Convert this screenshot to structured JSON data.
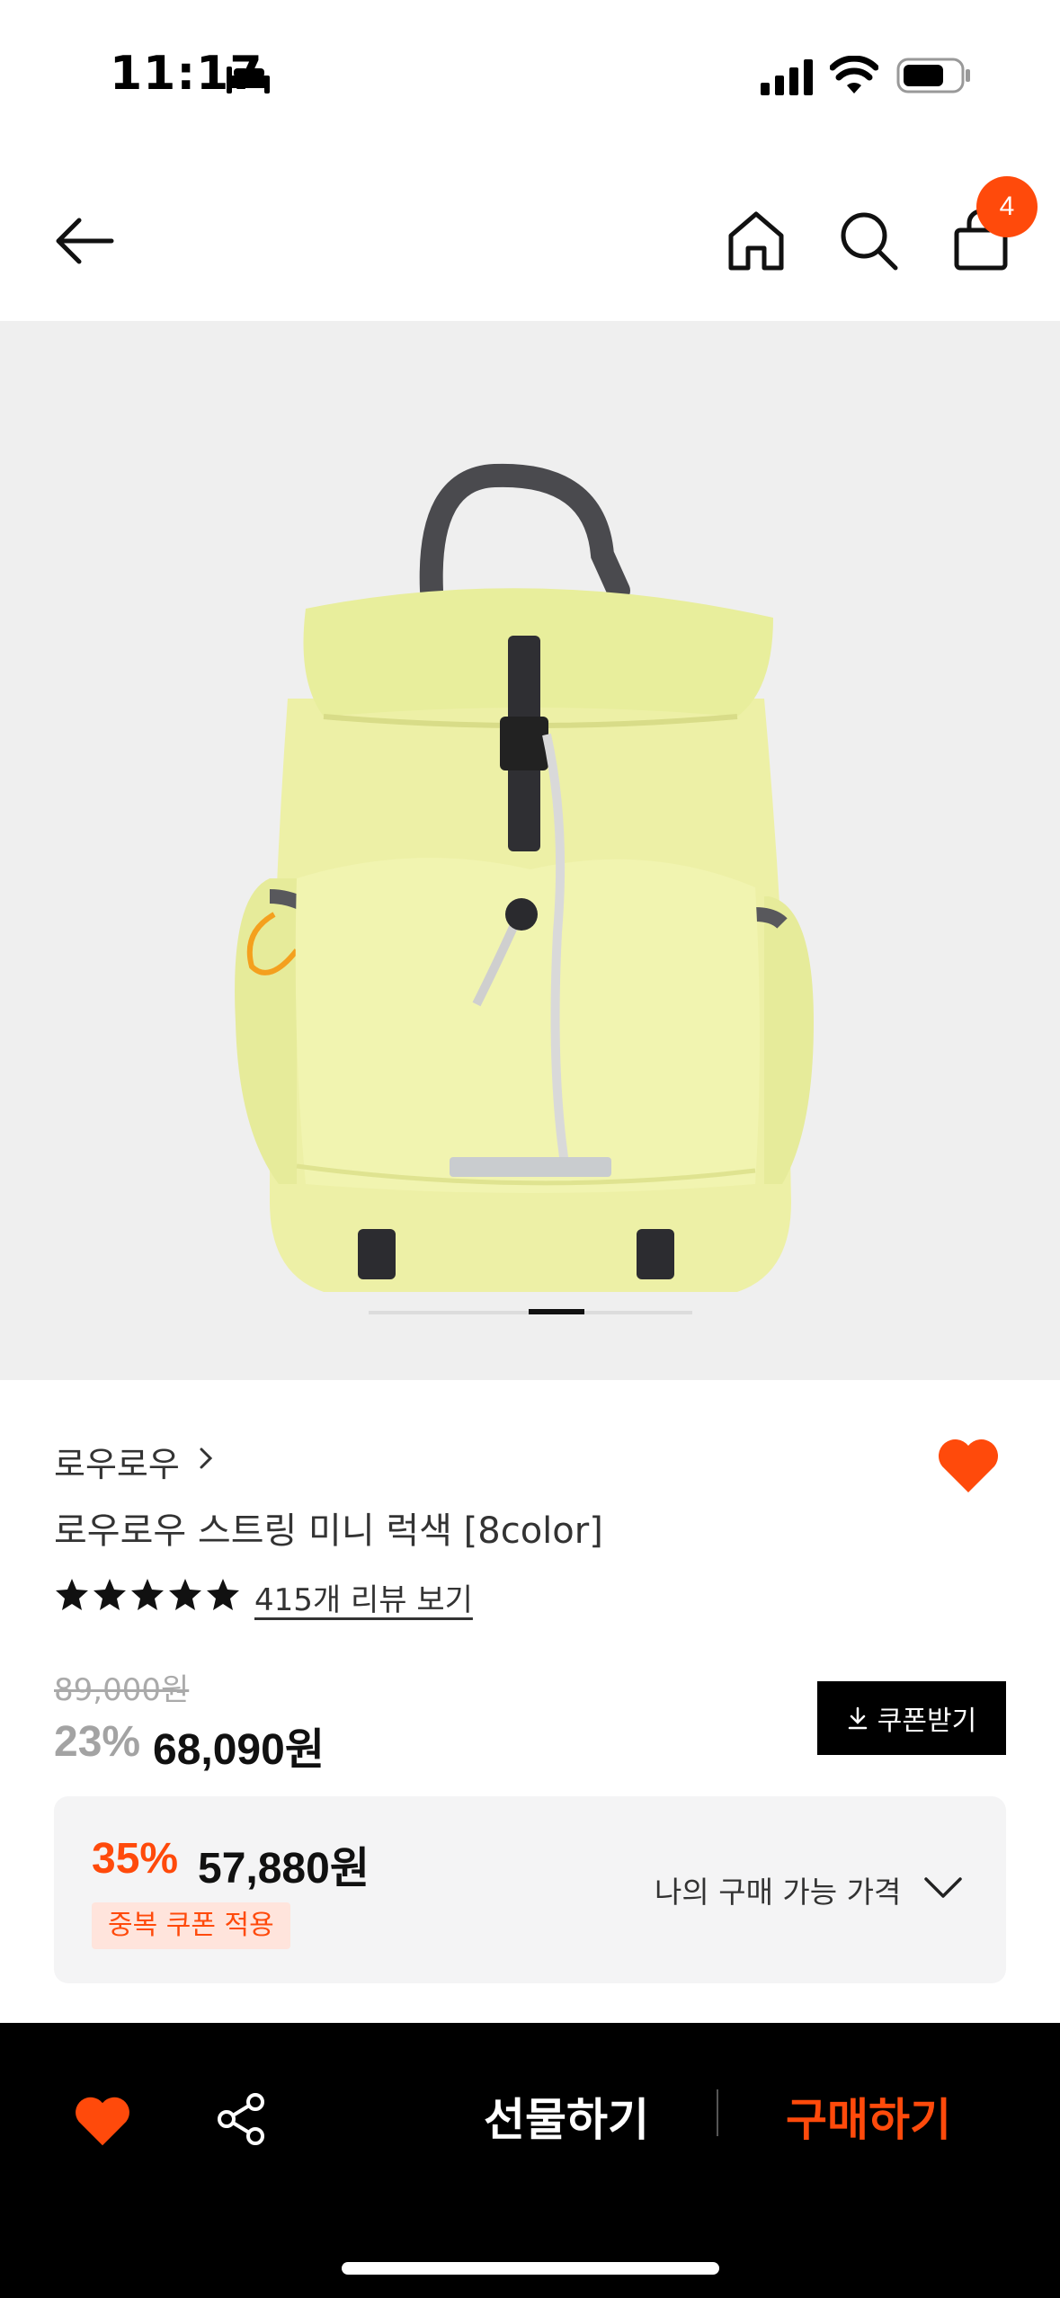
{
  "status_bar": {
    "time": "11:17"
  },
  "header": {
    "cart_count": "4"
  },
  "product": {
    "brand": "로우로우",
    "title": "로우로우 스트링 미니 럭색 [8color]",
    "rating_stars": 5,
    "review_link": "415개 리뷰 보기",
    "original_price": "89,000원",
    "discount": "23%",
    "price": "68,090원",
    "coupon_button": "쿠폰받기"
  },
  "best_price": {
    "discount": "35%",
    "price": "57,880원",
    "tag": "중복 쿠폰 적용",
    "my_price_label": "나의 구매 가능 가격"
  },
  "bottom_bar": {
    "gift_label": "선물하기",
    "buy_label": "구매하기"
  },
  "icons": [
    "sleep-icon",
    "signal-icon",
    "wifi-icon",
    "battery-icon",
    "back-arrow-icon",
    "home-icon",
    "search-icon",
    "shopping-bag-icon",
    "chevron-right-icon",
    "heart-icon",
    "star-icon",
    "download-icon",
    "chevron-down-icon",
    "share-icon"
  ],
  "colors": {
    "accent": "#ff4a0b",
    "bar": "#000000",
    "box_bg": "#f4f4f5"
  }
}
